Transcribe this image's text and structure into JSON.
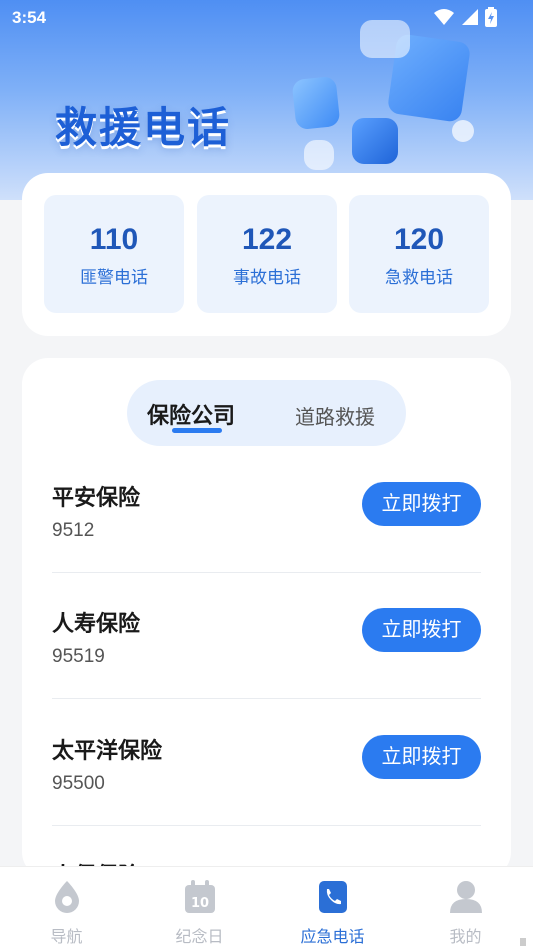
{
  "status_bar": {
    "time": "3:54"
  },
  "hero": {
    "title": "救援电话"
  },
  "hotlines": [
    {
      "number": "110",
      "label": "匪警电话"
    },
    {
      "number": "122",
      "label": "事故电话"
    },
    {
      "number": "120",
      "label": "急救电话"
    }
  ],
  "tabs": {
    "active": "保险公司",
    "inactive": "道路救援"
  },
  "insurers": [
    {
      "name": "平安保险",
      "phone": "9512",
      "action": "立即拨打"
    },
    {
      "name": "人寿保险",
      "phone": "95519",
      "action": "立即拨打"
    },
    {
      "name": "太平洋保险",
      "phone": "95500",
      "action": "立即拨打"
    },
    {
      "name": "人保保险",
      "phone": "",
      "action": ""
    }
  ],
  "bottom_nav": [
    {
      "label": "导航",
      "icon": "navigation-icon"
    },
    {
      "label": "纪念日",
      "icon": "calendar-icon"
    },
    {
      "label": "应急电话",
      "icon": "phone-icon",
      "active": true
    },
    {
      "label": "我的",
      "icon": "user-icon"
    }
  ],
  "colors": {
    "accent": "#2b7bf0",
    "hotline_bg": "#ecf3fd",
    "tab_bg": "#e7f0fd"
  }
}
